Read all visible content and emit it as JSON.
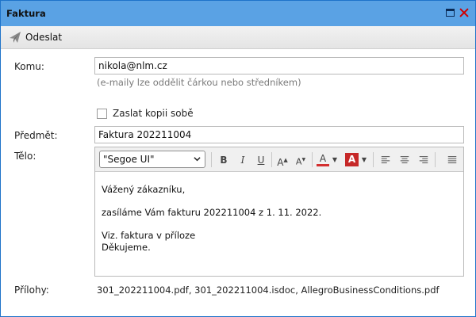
{
  "window": {
    "title": "Faktura"
  },
  "toolbar": {
    "send_label": "Odeslat"
  },
  "form": {
    "to_label": "Komu:",
    "to_value": "nikola@nlm.cz",
    "to_hint": "(e-maily lze oddělit čárkou nebo středníkem)",
    "copy_label": "Zaslat kopii sobě",
    "copy_checked": false,
    "subject_label": "Předmět:",
    "subject_value": "Faktura 202211004",
    "body_label": "Tělo:",
    "attachments_label": "Přílohy:",
    "attachments_value": "301_202211004.pdf, 301_202211004.isdoc, AllegroBusinessConditions.pdf"
  },
  "editor": {
    "font_value": "\"Segoe UI\"",
    "bold": "B",
    "italic": "I",
    "underline": "U",
    "grow": "A",
    "shrink": "A",
    "font_color": "A",
    "highlight": "A",
    "font_color_hex": "#d32f2f",
    "highlight_hex": "#c62828",
    "body_lines": [
      "Vážený zákazníku,",
      "zasíláme Vám fakturu 202211004 z 1. 11. 2022.",
      "Viz. faktura v příloze",
      "Děkujeme."
    ]
  },
  "icons": {
    "send": "paper-plane-icon",
    "maximize": "maximize-icon",
    "close": "close-icon"
  }
}
